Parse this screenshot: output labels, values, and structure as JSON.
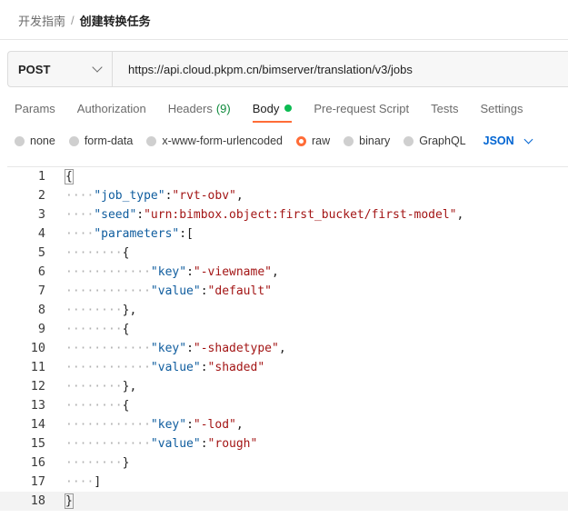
{
  "breadcrumb": {
    "parent": "开发指南",
    "separator": "/",
    "current": "创建转换任务"
  },
  "request": {
    "method": "POST",
    "url": "https://api.cloud.pkpm.cn/bimserver/translation/v3/jobs"
  },
  "tabs": {
    "params": "Params",
    "authorization": "Authorization",
    "headers": "Headers",
    "headers_count": "(9)",
    "body": "Body",
    "prerequest": "Pre-request Script",
    "tests": "Tests",
    "settings": "Settings",
    "active": "Body"
  },
  "body_types": {
    "none": "none",
    "form_data": "form-data",
    "urlencoded": "x-www-form-urlencoded",
    "raw": "raw",
    "binary": "binary",
    "graphql": "GraphQL",
    "selected": "raw",
    "language": "JSON"
  },
  "editor": {
    "line_numbers": [
      "1",
      "2",
      "3",
      "4",
      "5",
      "6",
      "7",
      "8",
      "9",
      "10",
      "11",
      "12",
      "13",
      "14",
      "15",
      "16",
      "17",
      "18"
    ],
    "tokens": {
      "l2_key": "\"job_type\"",
      "l2_val": "\"rvt-obv\"",
      "l3_key": "\"seed\"",
      "l3_val": "\"urn:bimbox.object:first_bucket/first-model\"",
      "l4_key": "\"parameters\"",
      "l6_key": "\"key\"",
      "l6_val": "\"-viewname\"",
      "l7_key": "\"value\"",
      "l7_val": "\"default\"",
      "l10_key": "\"key\"",
      "l10_val": "\"-shadetype\"",
      "l11_key": "\"value\"",
      "l11_val": "\"shaded\"",
      "l14_key": "\"key\"",
      "l14_val": "\"-lod\"",
      "l15_key": "\"value\"",
      "l15_val": "\"rough\""
    }
  },
  "colors": {
    "accent": "#ff6c37",
    "link": "#0265d2",
    "status_green": "#0cbb52",
    "json_key": "#0e5c9e",
    "json_string": "#a31515"
  }
}
